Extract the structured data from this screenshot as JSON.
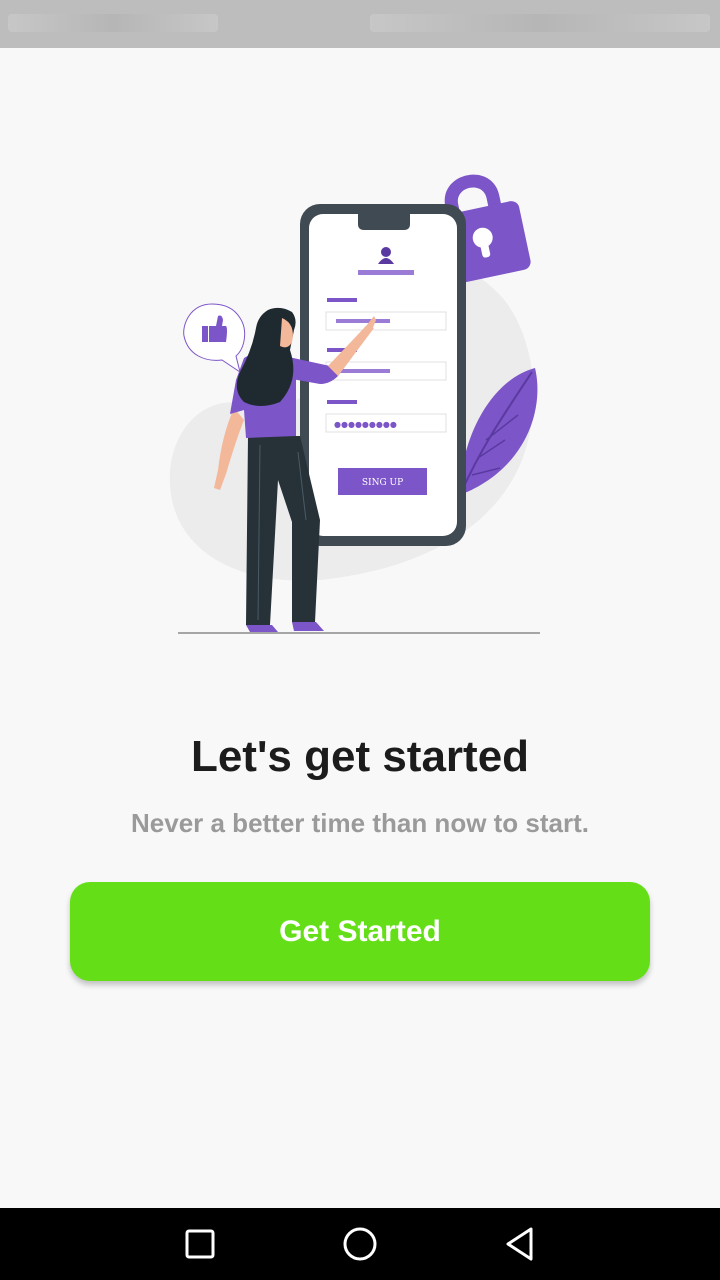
{
  "status_bar": {
    "background": "#bdbdbd"
  },
  "illustration": {
    "form_button_label": "SING UP",
    "password_dots": "●●●●●●●●●",
    "icons": [
      "padlock-icon",
      "thumbs-up-icon",
      "user-icon"
    ],
    "accent": "#7c55c8"
  },
  "main": {
    "title": "Let's get started",
    "subtitle": "Never a better time than now to start."
  },
  "cta": {
    "label": "Get Started",
    "color": "#64df17"
  },
  "nav_bar": {
    "buttons": [
      "recent-apps-icon",
      "home-icon",
      "back-icon"
    ]
  }
}
